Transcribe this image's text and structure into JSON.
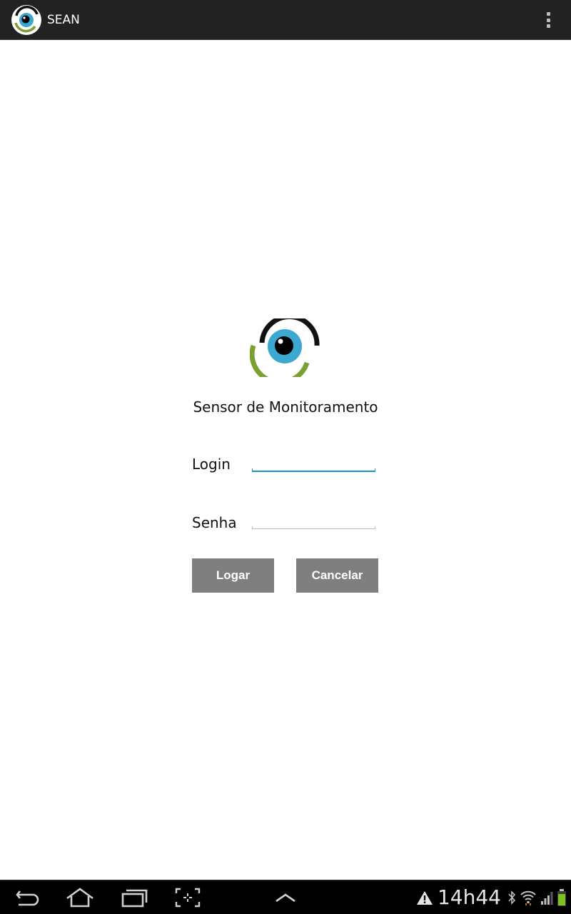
{
  "app": {
    "title": "SEAN",
    "subtitle": "Sensor de Monitoramento"
  },
  "form": {
    "login_label": "Login",
    "login_value": "",
    "senha_label": "Senha",
    "senha_value": ""
  },
  "buttons": {
    "logar_label": "Logar",
    "cancelar_label": "Cancelar"
  },
  "status_bar": {
    "time": "14h44",
    "icons": [
      "warning-icon",
      "bluetooth-icon",
      "wifi-icon",
      "signal-icon",
      "battery-icon"
    ]
  },
  "nav_bar": {
    "icons": [
      "back-icon",
      "home-icon",
      "recent-apps-icon",
      "screenshot-icon",
      "chevron-up-icon"
    ]
  },
  "colors": {
    "action_bar": "#222222",
    "accent": "#1e90c8",
    "button": "#7f7f7f",
    "logo_blue": "#3aa8d0",
    "logo_green": "#7aa032"
  }
}
